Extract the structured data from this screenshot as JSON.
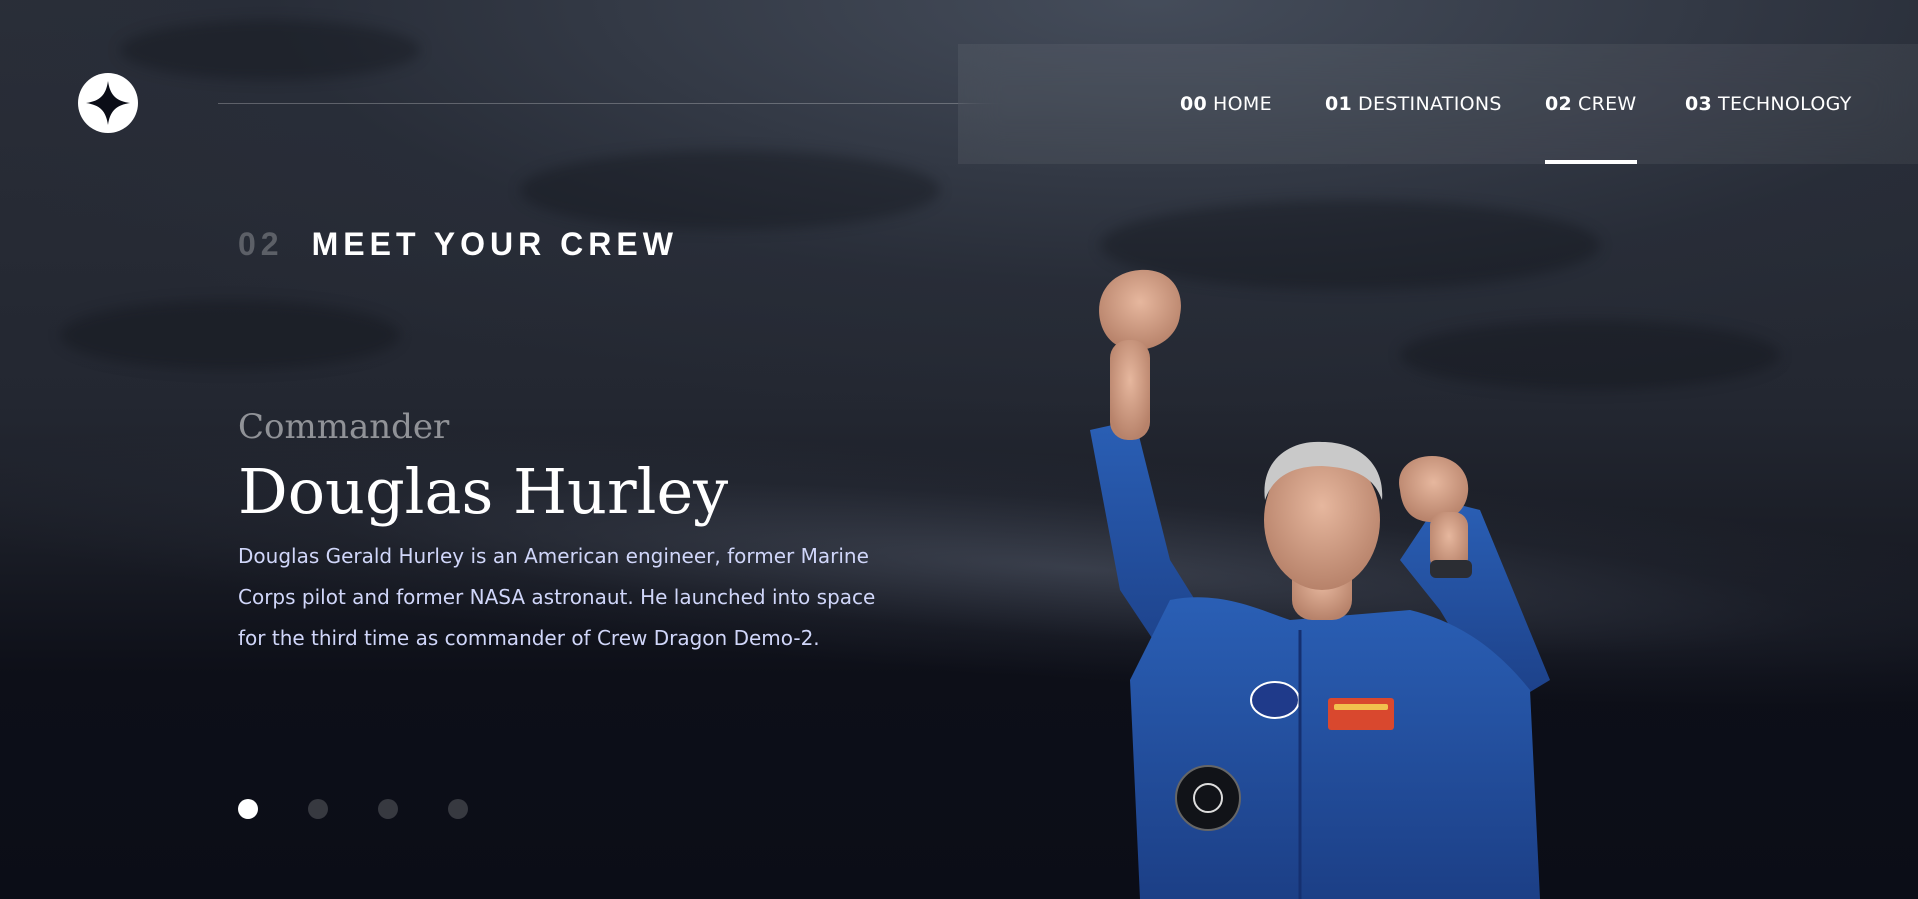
{
  "nav": {
    "items": [
      {
        "num": "00",
        "label": "HOME"
      },
      {
        "num": "01",
        "label": "DESTINATIONS"
      },
      {
        "num": "02",
        "label": "CREW"
      },
      {
        "num": "03",
        "label": "TECHNOLOGY"
      }
    ],
    "active_index": 2
  },
  "page": {
    "heading_num": "02",
    "heading_text": "MEET YOUR CREW"
  },
  "crew": {
    "role": "Commander",
    "name": "Douglas Hurley",
    "bio": "Douglas Gerald Hurley is an American engineer, former Marine Corps pilot and former NASA astronaut. He launched into space for the third time as commander of Crew Dragon Demo-2.",
    "slide_count": 4,
    "active_slide": 0
  },
  "icons": {
    "logo": "star-icon"
  },
  "colors": {
    "background": "#0b0d17",
    "text_light": "#d0d6f9",
    "accent_white": "#ffffff"
  }
}
